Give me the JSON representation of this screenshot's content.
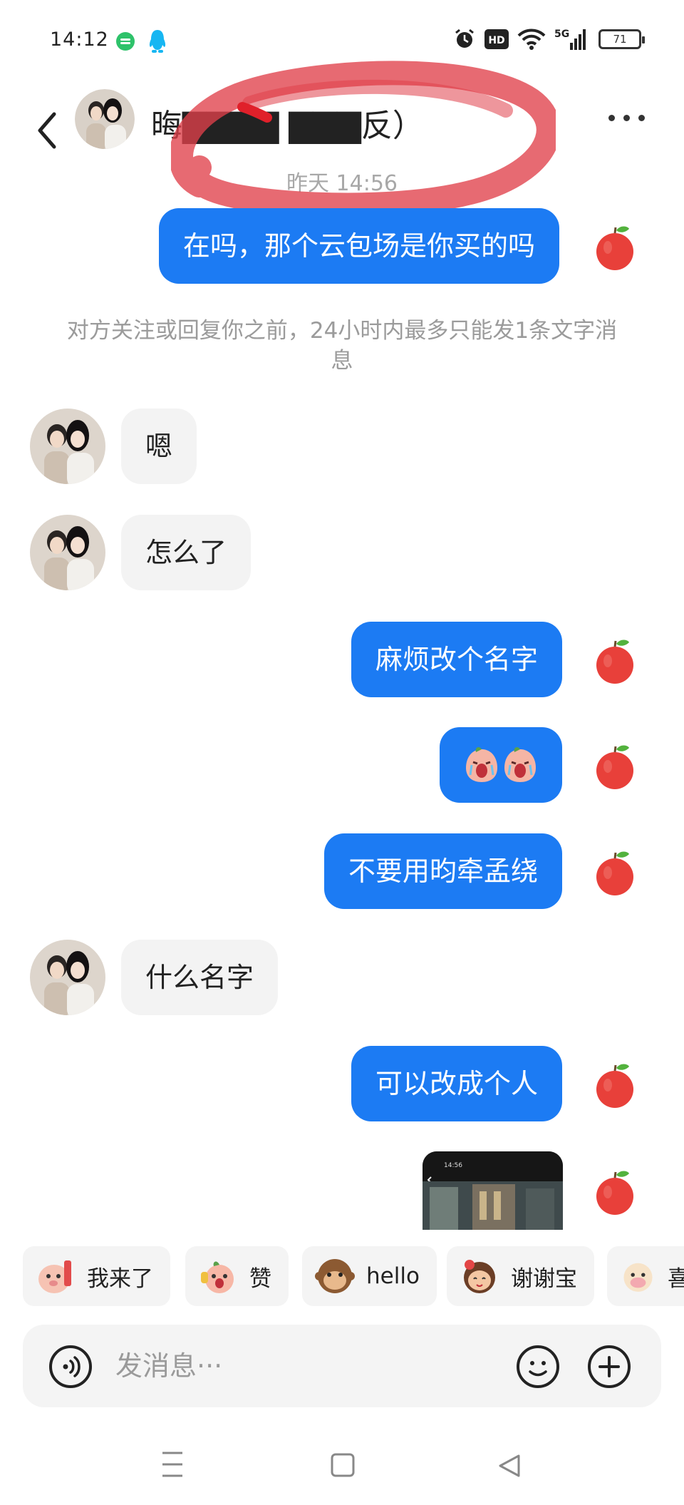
{
  "status_bar": {
    "time": "14:12",
    "network": "5G",
    "hd_label": "HD",
    "battery": "71"
  },
  "header": {
    "contact_name": "晦▇▇▇▇ ▇▇▇反）",
    "timestamp": "昨天 14:56"
  },
  "messages": [
    {
      "direction": "out",
      "text": "在吗，那个云包场是你买的吗"
    },
    {
      "direction": "notice",
      "text": "对方关注或回复你之前，24小时内最多只能发1条文字消息"
    },
    {
      "direction": "in",
      "text": "嗯"
    },
    {
      "direction": "in",
      "text": "怎么了"
    },
    {
      "direction": "out",
      "text": "麻烦改个名字"
    },
    {
      "direction": "out",
      "type": "stickers",
      "icon": "crying-peach-sticker"
    },
    {
      "direction": "out",
      "text": "不要用昀牵孟绕"
    },
    {
      "direction": "in",
      "text": "什么名字"
    },
    {
      "direction": "out",
      "text": "可以改成个人"
    },
    {
      "direction": "out",
      "type": "image",
      "icon": "screenshot-thumbnail"
    }
  ],
  "quick_replies": [
    "我来了",
    "赞",
    "hello",
    "谢谢宝",
    "喜"
  ],
  "input": {
    "placeholder": "发消息···"
  },
  "colors": {
    "accent": "#1c7bf3",
    "incoming_bubble": "#f3f3f3",
    "scribble": "#e0404a"
  }
}
